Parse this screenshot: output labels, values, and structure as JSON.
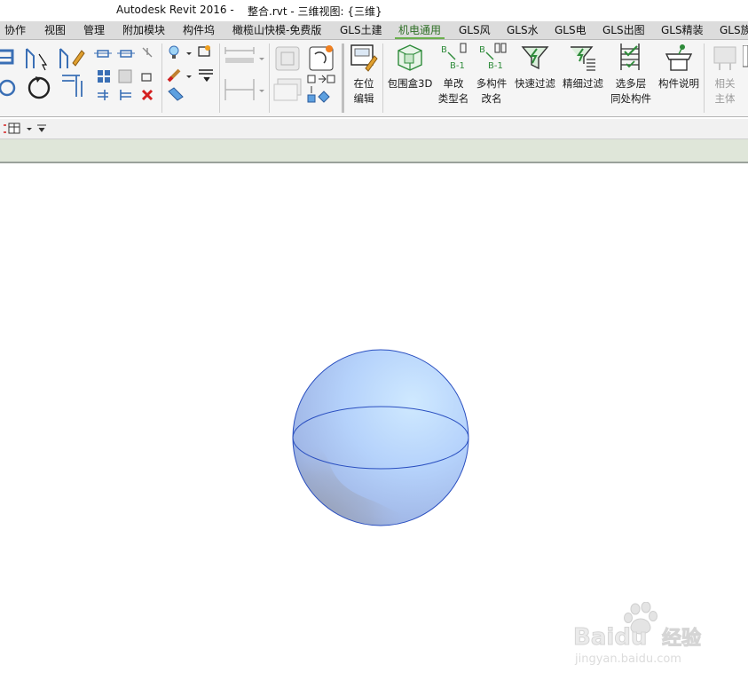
{
  "window": {
    "app_title": "Autodesk Revit 2016 -",
    "file_title": "整合.rvt - 三维视图: {三维}"
  },
  "tabs": [
    {
      "label": "协作",
      "active": false
    },
    {
      "label": "视图",
      "active": false
    },
    {
      "label": "管理",
      "active": false
    },
    {
      "label": "附加模块",
      "active": false
    },
    {
      "label": "构件坞",
      "active": false
    },
    {
      "label": "橄榄山快模-免费版",
      "active": false
    },
    {
      "label": "GLS土建",
      "active": false
    },
    {
      "label": "机电通用",
      "active": true
    },
    {
      "label": "GLS风",
      "active": false
    },
    {
      "label": "GLS水",
      "active": false
    },
    {
      "label": "GLS电",
      "active": false
    },
    {
      "label": "GLS出图",
      "active": false
    },
    {
      "label": "GLS精装",
      "active": false
    },
    {
      "label": "GLS族",
      "active": false
    }
  ],
  "ribbon": {
    "edit_in_place": {
      "line1": "在位",
      "line2": "编辑"
    },
    "bbox3d": {
      "label": "包围盒3D"
    },
    "single_rename": {
      "line1": "单改",
      "line2": "类型名"
    },
    "multi_rename": {
      "line1": "多构件",
      "line2": "改名"
    },
    "quick_filter": {
      "label": "快速过滤"
    },
    "fine_filter": {
      "label": "精细过滤"
    },
    "multi_level": {
      "line1": "选多层",
      "line2": "同处构件"
    },
    "component_desc": {
      "label": "构件说明"
    },
    "related_host": {
      "line1": "相关",
      "line2": "主体"
    },
    "icon_text_b1": "B-1",
    "icon_text_b": "B"
  },
  "canvas": {
    "object": "sphere",
    "sphere_color": "#a9c8f7",
    "edge_color": "#2a4fc0"
  },
  "watermark": {
    "brand": "Baidu",
    "brand_cn": "经验",
    "url": "jingyan.baidu.com"
  },
  "colors": {
    "active_tab": "#6ab04c",
    "option_bar": "#dfe6d9",
    "delete_red": "#d42020"
  }
}
